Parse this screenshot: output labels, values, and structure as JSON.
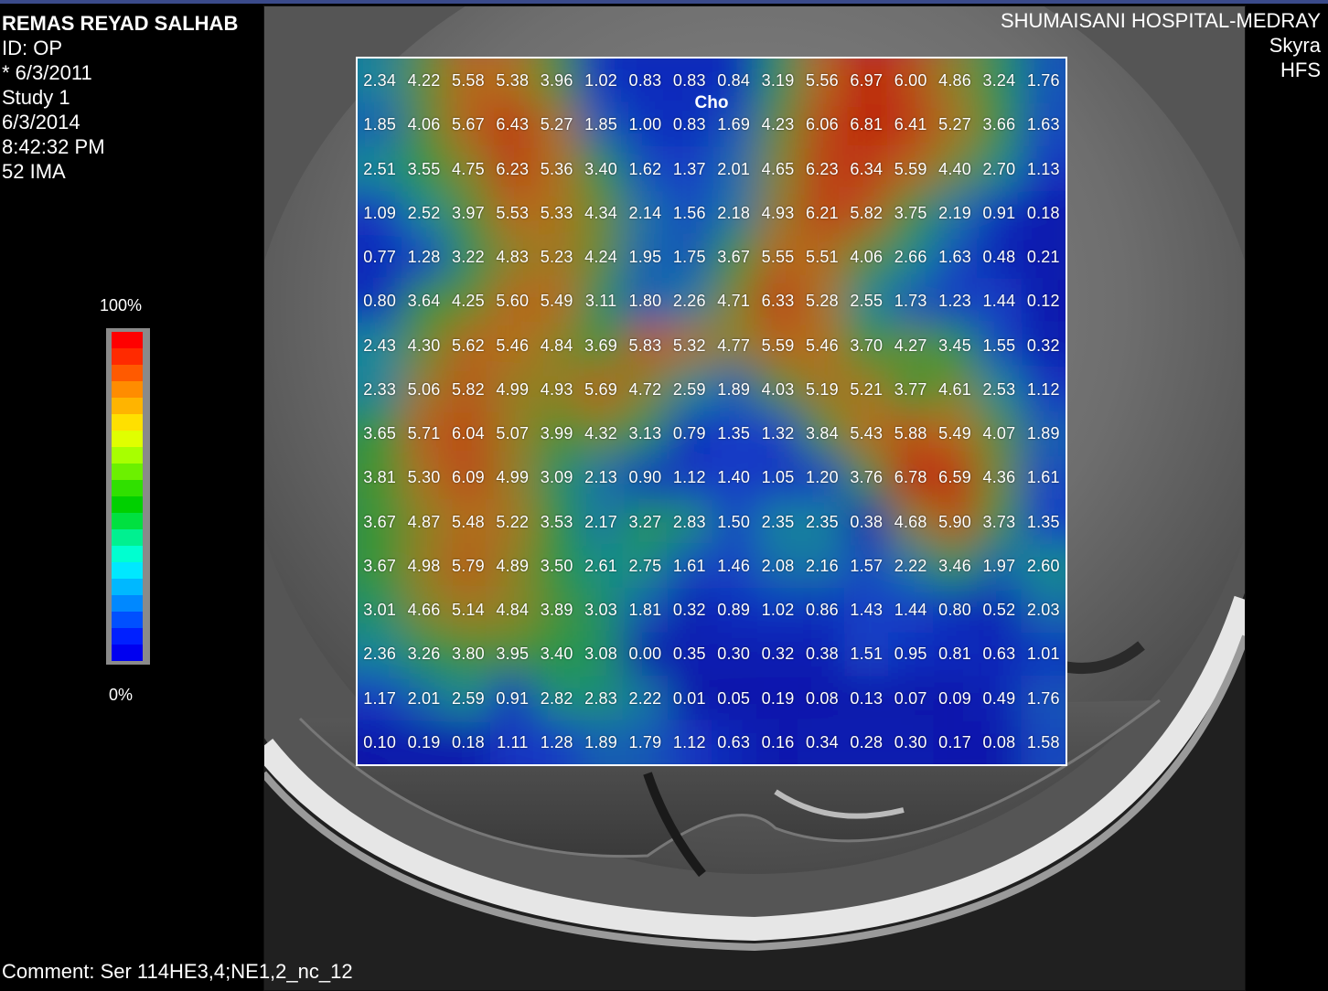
{
  "patient": {
    "name": "REMAS REYAD SALHAB",
    "id": "ID: OP",
    "birth": "* 6/3/2011",
    "study": "Study 1",
    "date": "6/3/2014",
    "time": "8:42:32 PM",
    "image": "52 IMA"
  },
  "institution": {
    "name": "SHUMAISANI HOSPITAL-MEDRAY",
    "scanner": "Skyra",
    "position": "HFS"
  },
  "comment": "Comment: Ser 114HE3,4;NE1,2_nc_12",
  "scale": {
    "max_label": "100%",
    "min_label": "0%",
    "colors": [
      "#ff0000",
      "#ff2a00",
      "#ff5a00",
      "#ff8c00",
      "#ffb400",
      "#ffe000",
      "#e0ff00",
      "#a8ff00",
      "#6cf000",
      "#30e000",
      "#00d000",
      "#00e040",
      "#00f090",
      "#00ffd0",
      "#00e8ff",
      "#00b8ff",
      "#0088ff",
      "#0050ff",
      "#0020ff",
      "#0000f0"
    ]
  },
  "map": {
    "metabolite": "Cho",
    "colors": {
      "low": "#0a1ea8",
      "high": "#c0200a"
    },
    "values": [
      [
        "2.34",
        "4.22",
        "5.58",
        "5.38",
        "3.96",
        "1.02",
        "0.83",
        "0.83",
        "0.84",
        "3.19",
        "5.56",
        "6.97",
        "6.00",
        "4.86",
        "3.24",
        "1.76"
      ],
      [
        "1.85",
        "4.06",
        "5.67",
        "6.43",
        "5.27",
        "1.85",
        "1.00",
        "0.83",
        "1.69",
        "4.23",
        "6.06",
        "6.81",
        "6.41",
        "5.27",
        "3.66",
        "1.63"
      ],
      [
        "2.51",
        "3.55",
        "4.75",
        "6.23",
        "5.36",
        "3.40",
        "1.62",
        "1.37",
        "2.01",
        "4.65",
        "6.23",
        "6.34",
        "5.59",
        "4.40",
        "2.70",
        "1.13"
      ],
      [
        "1.09",
        "2.52",
        "3.97",
        "5.53",
        "5.33",
        "4.34",
        "2.14",
        "1.56",
        "2.18",
        "4.93",
        "6.21",
        "5.82",
        "3.75",
        "2.19",
        "0.91",
        "0.18"
      ],
      [
        "0.77",
        "1.28",
        "3.22",
        "4.83",
        "5.23",
        "4.24",
        "1.95",
        "1.75",
        "3.67",
        "5.55",
        "5.51",
        "4.06",
        "2.66",
        "1.63",
        "0.48",
        "0.21"
      ],
      [
        "0.80",
        "3.64",
        "4.25",
        "5.60",
        "5.49",
        "3.11",
        "1.80",
        "2.26",
        "4.71",
        "6.33",
        "5.28",
        "2.55",
        "1.73",
        "1.23",
        "1.44",
        "0.12"
      ],
      [
        "2.43",
        "4.30",
        "5.62",
        "5.46",
        "4.84",
        "3.69",
        "5.83",
        "5.32",
        "4.77",
        "5.59",
        "5.46",
        "3.70",
        "4.27",
        "3.45",
        "1.55",
        "0.32"
      ],
      [
        "2.33",
        "5.06",
        "5.82",
        "4.99",
        "4.93",
        "5.69",
        "4.72",
        "2.59",
        "1.89",
        "4.03",
        "5.19",
        "5.21",
        "3.77",
        "4.61",
        "2.53",
        "1.12"
      ],
      [
        "3.65",
        "5.71",
        "6.04",
        "5.07",
        "3.99",
        "4.32",
        "3.13",
        "0.79",
        "1.35",
        "1.32",
        "3.84",
        "5.43",
        "5.88",
        "5.49",
        "4.07",
        "1.89"
      ],
      [
        "3.81",
        "5.30",
        "6.09",
        "4.99",
        "3.09",
        "2.13",
        "0.90",
        "1.12",
        "1.40",
        "1.05",
        "1.20",
        "3.76",
        "6.78",
        "6.59",
        "4.36",
        "1.61"
      ],
      [
        "3.67",
        "4.87",
        "5.48",
        "5.22",
        "3.53",
        "2.17",
        "3.27",
        "2.83",
        "1.50",
        "2.35",
        "2.35",
        "0.38",
        "4.68",
        "5.90",
        "3.73",
        "1.35"
      ],
      [
        "3.67",
        "4.98",
        "5.79",
        "4.89",
        "3.50",
        "2.61",
        "2.75",
        "1.61",
        "1.46",
        "2.08",
        "2.16",
        "1.57",
        "2.22",
        "3.46",
        "1.97",
        "2.60"
      ],
      [
        "3.01",
        "4.66",
        "5.14",
        "4.84",
        "3.89",
        "3.03",
        "1.81",
        "0.32",
        "0.89",
        "1.02",
        "0.86",
        "1.43",
        "1.44",
        "0.80",
        "0.52",
        "2.03"
      ],
      [
        "2.36",
        "3.26",
        "3.80",
        "3.95",
        "3.40",
        "3.08",
        "0.00",
        "0.35",
        "0.30",
        "0.32",
        "0.38",
        "1.51",
        "0.95",
        "0.81",
        "0.63",
        "1.01"
      ],
      [
        "1.17",
        "2.01",
        "2.59",
        "0.91",
        "2.82",
        "2.83",
        "2.22",
        "0.01",
        "0.05",
        "0.19",
        "0.08",
        "0.13",
        "0.07",
        "0.09",
        "0.49",
        "1.76"
      ],
      [
        "0.10",
        "0.19",
        "0.18",
        "1.11",
        "1.28",
        "1.89",
        "1.79",
        "1.12",
        "0.63",
        "0.16",
        "0.34",
        "0.28",
        "0.30",
        "0.17",
        "0.08",
        "1.58"
      ]
    ]
  }
}
